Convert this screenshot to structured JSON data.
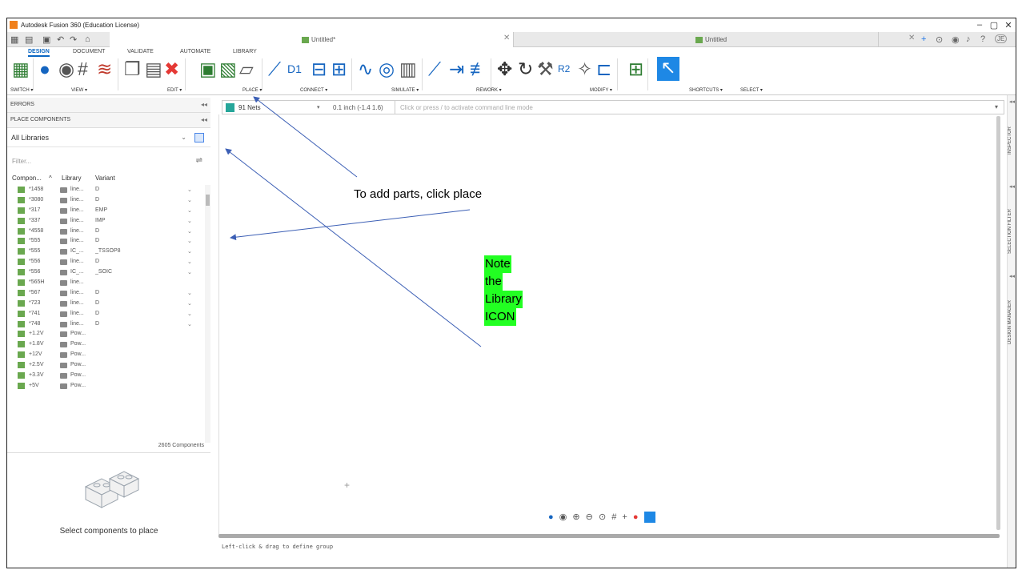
{
  "window": {
    "title": "Autodesk Fusion 360 (Education License)"
  },
  "tabs": [
    {
      "label": "Untitled*",
      "active": true
    },
    {
      "label": "Untitled",
      "active": false
    }
  ],
  "ribbon": {
    "menus": [
      "DESIGN",
      "DOCUMENT",
      "VALIDATE",
      "AUTOMATE",
      "LIBRARY"
    ],
    "groups": [
      "SWITCH ▾",
      "VIEW ▾",
      "EDIT ▾",
      "PLACE ▾",
      "CONNECT ▾",
      "SIMULATE ▾",
      "REWORK ▾",
      "MODIFY ▾",
      "SHORTCUTS ▾",
      "SELECT ▾"
    ]
  },
  "left_panel": {
    "errors_label": "ERRORS",
    "place_components_label": "PLACE COMPONENTS",
    "library_select": "All Libraries",
    "filter_placeholder": "Filter...",
    "columns": [
      "Compon...",
      "Library",
      "Variant"
    ],
    "rows": [
      {
        "name": "*1458",
        "library": "line...",
        "variant": "D",
        "dropdown": true
      },
      {
        "name": "*3080",
        "library": "line...",
        "variant": "D",
        "dropdown": true
      },
      {
        "name": "*317",
        "library": "line...",
        "variant": "EMP",
        "dropdown": true
      },
      {
        "name": "*337",
        "library": "line...",
        "variant": "IMP",
        "dropdown": true
      },
      {
        "name": "*4558",
        "library": "line...",
        "variant": "D",
        "dropdown": true
      },
      {
        "name": "*555",
        "library": "line...",
        "variant": "D",
        "dropdown": true
      },
      {
        "name": "*555",
        "library": "IC_...",
        "variant": "_TSSOP8",
        "dropdown": true
      },
      {
        "name": "*556",
        "library": "line...",
        "variant": "D",
        "dropdown": true
      },
      {
        "name": "*556",
        "library": "IC_...",
        "variant": "_SOIC",
        "dropdown": true
      },
      {
        "name": "*565H",
        "library": "line...",
        "variant": "",
        "dropdown": false
      },
      {
        "name": "*567",
        "library": "line...",
        "variant": "D",
        "dropdown": true
      },
      {
        "name": "*723",
        "library": "line...",
        "variant": "D",
        "dropdown": true
      },
      {
        "name": "*741",
        "library": "line...",
        "variant": "D",
        "dropdown": true
      },
      {
        "name": "*748",
        "library": "line...",
        "variant": "D",
        "dropdown": true
      },
      {
        "name": "+1.2V",
        "library": "Pow...",
        "variant": "",
        "dropdown": false
      },
      {
        "name": "+1.8V",
        "library": "Pow...",
        "variant": "",
        "dropdown": false
      },
      {
        "name": "+12V",
        "library": "Pow...",
        "variant": "",
        "dropdown": false
      },
      {
        "name": "+2.5V",
        "library": "Pow...",
        "variant": "",
        "dropdown": false
      },
      {
        "name": "+3.3V",
        "library": "Pow...",
        "variant": "",
        "dropdown": false
      },
      {
        "name": "+5V",
        "library": "Pow...",
        "variant": "",
        "dropdown": false
      }
    ],
    "component_count": "2605 Components",
    "select_message": "Select components to place"
  },
  "command_bar": {
    "nets": "91 Nets",
    "grid": "0.1 inch (-1.4 1.6)",
    "placeholder": "Click or press / to activate command line mode"
  },
  "status_text": "Left-click & drag to define group",
  "right_tabs": [
    "INSPECTOR",
    "SELECTION FILTER",
    "DESIGN MANAGER"
  ],
  "annotations": {
    "place_hint": "To add parts, click place",
    "library_note": [
      "Note",
      "the",
      "Library",
      "ICON"
    ]
  },
  "colors": {
    "accent": "#0a66c2",
    "highlight": "#22ff22",
    "arrow": "#3c5fb5"
  }
}
